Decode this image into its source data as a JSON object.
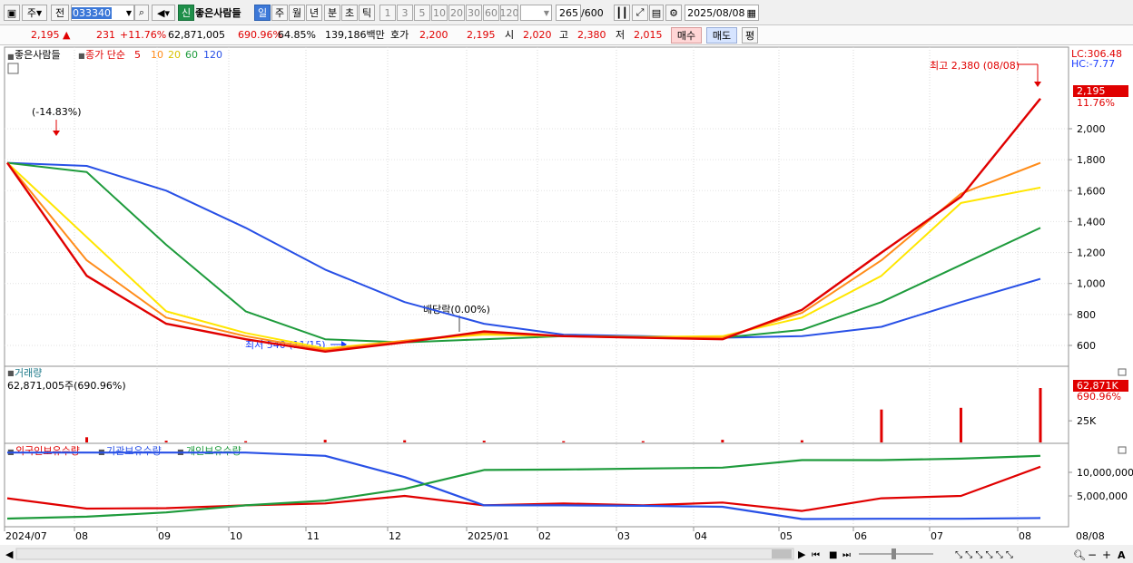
{
  "toolbar": {
    "mode_label": "주",
    "prev_label": "전",
    "code": "033340",
    "badge": "신",
    "stock_name": "좋은사람들",
    "periods": [
      "일",
      "주",
      "월",
      "년",
      "분",
      "초",
      "틱"
    ],
    "intervals": [
      "1",
      "3",
      "5",
      "10",
      "20",
      "30",
      "60",
      "120"
    ],
    "count": "265",
    "count_total": "/600",
    "date": "2025/08/08"
  },
  "quote": {
    "price": "2,195 ▲",
    "change": "231",
    "change_pct": "+11.76%",
    "volume": "62,871,005",
    "vol_ratio": "690.96%",
    "turnover": "64.85%",
    "amount": "139,186백만",
    "ask_label": "호가",
    "ask": "2,200",
    "bid": "2,195",
    "open_label": "시",
    "open": "2,020",
    "high_label": "고",
    "high": "2,380",
    "low_label": "저",
    "low": "2,015",
    "buy_label": "매수",
    "sell_label": "매도",
    "avg_label": "평"
  },
  "price_panel": {
    "stock_label": "좋은사람들",
    "ma_label": "종가 단순",
    "ma_periods": [
      "5",
      "10",
      "20",
      "60",
      "120"
    ],
    "ma_colors": [
      "#e00000",
      "#ff8c1a",
      "#ffe600",
      "#1e9b3c",
      "#2850e6"
    ],
    "lc": "LC:306.48",
    "hc": "HC:-7.77",
    "current_price": "2,195",
    "current_pct": "11.76%",
    "annotations": {
      "high": "최고 2,380 (08/08)",
      "low": "최저 540 (11/15)",
      "drop": "(-14.83%)",
      "dividend": "배당락(0.00%)"
    }
  },
  "volume_panel": {
    "title": "거래량",
    "value_text": "62,871,005주(690.96%)",
    "current": "62,871K",
    "pct": "690.96%"
  },
  "holdings_panel": {
    "titles": [
      "외국인보유수량",
      "기관보유수량",
      "개인보유수량"
    ],
    "colors": [
      "#e00000",
      "#2850e6",
      "#1e9b3c"
    ]
  },
  "x_axis": {
    "labels": [
      "2024/07",
      "08",
      "09",
      "10",
      "11",
      "12",
      "2025/01",
      "02",
      "03",
      "04",
      "05",
      "06",
      "07",
      "08"
    ],
    "right_label": "08/08"
  },
  "chart_data": [
    {
      "type": "line",
      "x": [
        "2024/07",
        "2024/08",
        "2024/09",
        "2024/10",
        "2024/11",
        "2024/12",
        "2025/01",
        "2025/02",
        "2025/03",
        "2025/04",
        "2025/05",
        "2025/06",
        "2025/07",
        "2025/08"
      ],
      "ylim": [
        450,
        2400
      ],
      "yticks": [
        600,
        800,
        1000,
        1200,
        1400,
        1600,
        1800,
        2000
      ],
      "series": [
        {
          "name": "5",
          "values": [
            1780,
            1050,
            740,
            640,
            560,
            620,
            690,
            660,
            650,
            640,
            830,
            1200,
            1560,
            2195
          ]
        },
        {
          "name": "10",
          "values": [
            1780,
            1150,
            780,
            660,
            570,
            630,
            680,
            660,
            650,
            650,
            810,
            1150,
            1580,
            1780
          ]
        },
        {
          "name": "20",
          "values": [
            1780,
            1300,
            820,
            680,
            580,
            630,
            670,
            660,
            655,
            660,
            780,
            1050,
            1520,
            1620
          ]
        },
        {
          "name": "60",
          "values": [
            1780,
            1720,
            1250,
            820,
            640,
            620,
            640,
            660,
            655,
            650,
            700,
            880,
            1120,
            1360
          ]
        },
        {
          "name": "120",
          "values": [
            1780,
            1760,
            1600,
            1360,
            1090,
            880,
            740,
            670,
            660,
            650,
            660,
            720,
            880,
            1030
          ]
        }
      ]
    },
    {
      "type": "bar",
      "x": [
        "2024/07",
        "2024/08",
        "2024/09",
        "2024/10",
        "2024/11",
        "2024/12",
        "2025/01",
        "2025/02",
        "2025/03",
        "2025/04",
        "2025/05",
        "2025/06",
        "2025/07",
        "2025/08"
      ],
      "yticks": [
        25000
      ],
      "series": [
        {
          "name": "거래량",
          "values": [
            0,
            6000,
            2000,
            1500,
            3000,
            2500,
            2000,
            1500,
            1500,
            3000,
            2500,
            38000,
            40000,
            62871
          ]
        }
      ]
    },
    {
      "type": "line",
      "x": [
        "2024/07",
        "2024/08",
        "2024/09",
        "2024/10",
        "2024/11",
        "2024/12",
        "2025/01",
        "2025/02",
        "2025/03",
        "2025/04",
        "2025/05",
        "2025/06",
        "2025/07",
        "2025/08"
      ],
      "yticks": [
        5000000,
        10000000
      ],
      "series": [
        {
          "name": "외국인보유수량",
          "values": [
            4500000,
            2300000,
            2400000,
            3000000,
            3400000,
            5000000,
            3000000,
            3400000,
            3000000,
            3600000,
            1800000,
            4500000,
            5000000,
            11200000
          ]
        },
        {
          "name": "기관보유수량",
          "values": [
            14200000,
            14200000,
            14200000,
            14200000,
            13500000,
            9000000,
            3000000,
            3000000,
            2900000,
            2700000,
            100000,
            150000,
            150000,
            300000
          ]
        },
        {
          "name": "개인보유수량",
          "values": [
            200000,
            600000,
            1500000,
            3000000,
            4000000,
            6500000,
            10500000,
            10600000,
            10800000,
            11000000,
            12600000,
            12600000,
            12900000,
            13500000
          ]
        }
      ]
    }
  ]
}
